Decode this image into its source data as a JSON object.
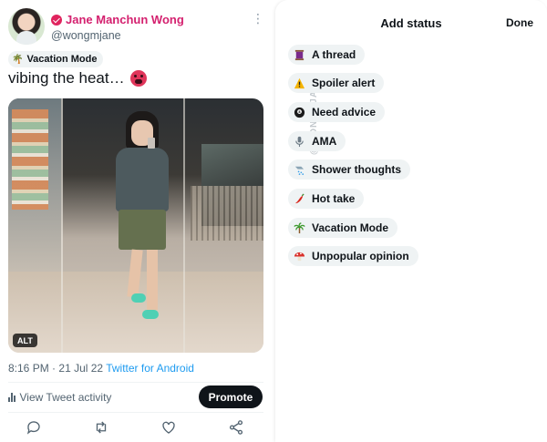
{
  "tweet": {
    "author_name": "Jane Manchun Wong",
    "handle": "@wongmjane",
    "status_chip": "Vacation Mode",
    "status_chip_icon": "palm-tree-icon",
    "text": "vibing the heat…",
    "text_emoji": "hot-face-icon",
    "image_badge": "ALT",
    "time": "8:16 PM",
    "separator": "·",
    "date": "21 Jul 22",
    "source": "Twitter for Android",
    "activity_label": "View Tweet activity",
    "promote_label": "Promote",
    "actions": [
      "reply-icon",
      "retweet-icon",
      "like-icon",
      "share-icon"
    ],
    "colors": {
      "name": "#d4216f",
      "link": "#1d9bf0",
      "button": "#0f1419",
      "chip": "#eff3f4"
    }
  },
  "sheet": {
    "title": "Add status",
    "done_label": "Done",
    "watermark": "@WONGMJANE",
    "statuses": [
      {
        "label": "A thread",
        "icon": "thread-spool-icon"
      },
      {
        "label": "Spoiler alert",
        "icon": "warning-icon"
      },
      {
        "label": "Need advice",
        "icon": "8-ball-icon"
      },
      {
        "label": "AMA",
        "icon": "microphone-icon"
      },
      {
        "label": "Shower thoughts",
        "icon": "shower-icon"
      },
      {
        "label": "Hot take",
        "icon": "chili-pepper-icon"
      },
      {
        "label": "Vacation Mode",
        "icon": "palm-tree-icon"
      },
      {
        "label": "Unpopular opinion",
        "icon": "mushroom-icon"
      }
    ]
  }
}
